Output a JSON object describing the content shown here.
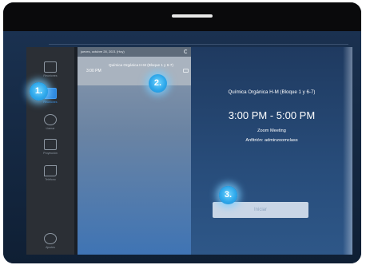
{
  "sidebar": {
    "items": [
      {
        "label": "Reuniones",
        "icon": "meetings-icon"
      },
      {
        "label": "Reuniones",
        "icon": "calendar-icon"
      },
      {
        "label": "Llamar",
        "icon": "phone-icon"
      },
      {
        "label": "Proyección",
        "icon": "presentation-icon"
      },
      {
        "label": "Teléfono",
        "icon": "phone-handset-icon"
      },
      {
        "label": "Ajustes",
        "icon": "gear-icon"
      }
    ]
  },
  "list": {
    "header_date": "jueves, octubre 28, 2021 (Hoy)",
    "item_time": "3:00 PM",
    "item_title": "Química Orgánica H-M (Bloque 1 y 6-7)"
  },
  "detail": {
    "title": "Química Orgánica H-M (Bloque 1 y 6-7)",
    "time_range": "3:00 PM - 5:00 PM",
    "meeting_type": "Zoom Meeting",
    "host": "Anfitrión: adminzoomclass",
    "start_label": "Iniciar"
  },
  "callouts": [
    "1.",
    "2.",
    "3."
  ],
  "colors": {
    "accent": "#2ea7ea",
    "active_nav": "#2a86e0"
  }
}
